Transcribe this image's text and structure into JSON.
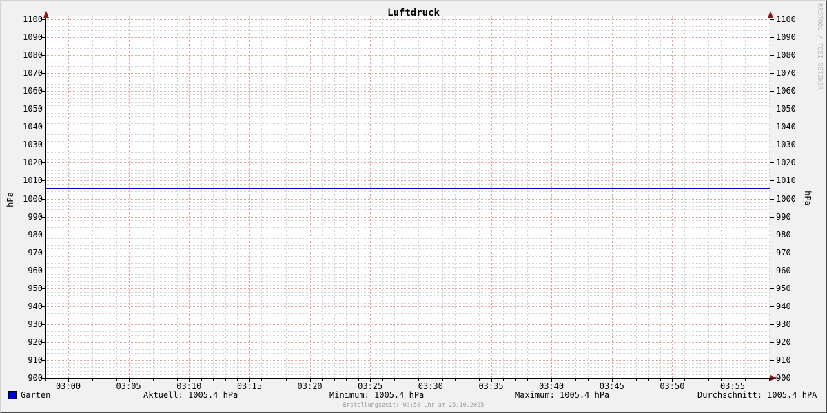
{
  "title": "Luftdruck",
  "watermark": "RRDTOOL / TOBI OETIKER",
  "footer_note": "Erstellungszeit: 03:58 Uhr am 25.10.2025",
  "axis": {
    "left_label": "hPa",
    "right_label": "hPa"
  },
  "legend": {
    "series_label": "Garten",
    "series_color": "#0000cc",
    "stats": [
      "Aktuell: 1005.4 hPa",
      "Minimum: 1005.4 hPa",
      "Maximum: 1005.4 hPa",
      "Durchschnitt: 1005.4 hPA"
    ]
  },
  "chart_data": {
    "type": "line",
    "title": "Luftdruck",
    "ylabel": "hPa",
    "ylim": [
      900,
      1100
    ],
    "ytick_step": 10,
    "ytick_minor_step": 2,
    "xtick_labels": [
      "03:00",
      "03:05",
      "03:10",
      "03:15",
      "03:20",
      "03:25",
      "03:30",
      "03:35",
      "03:40",
      "03:45",
      "03:50",
      "03:55"
    ],
    "xtick_major_every_minutes": 5,
    "xtick_minor_every_minutes": 1,
    "grid": true,
    "legend_position": "bottom",
    "series": [
      {
        "name": "Garten",
        "color": "#0000cc",
        "constant_value": 1005.4
      }
    ],
    "stats": {
      "aktuell_hpa": 1005.4,
      "minimum_hpa": 1005.4,
      "maximum_hpa": 1005.4,
      "durchschnitt_hpa": 1005.4
    }
  }
}
